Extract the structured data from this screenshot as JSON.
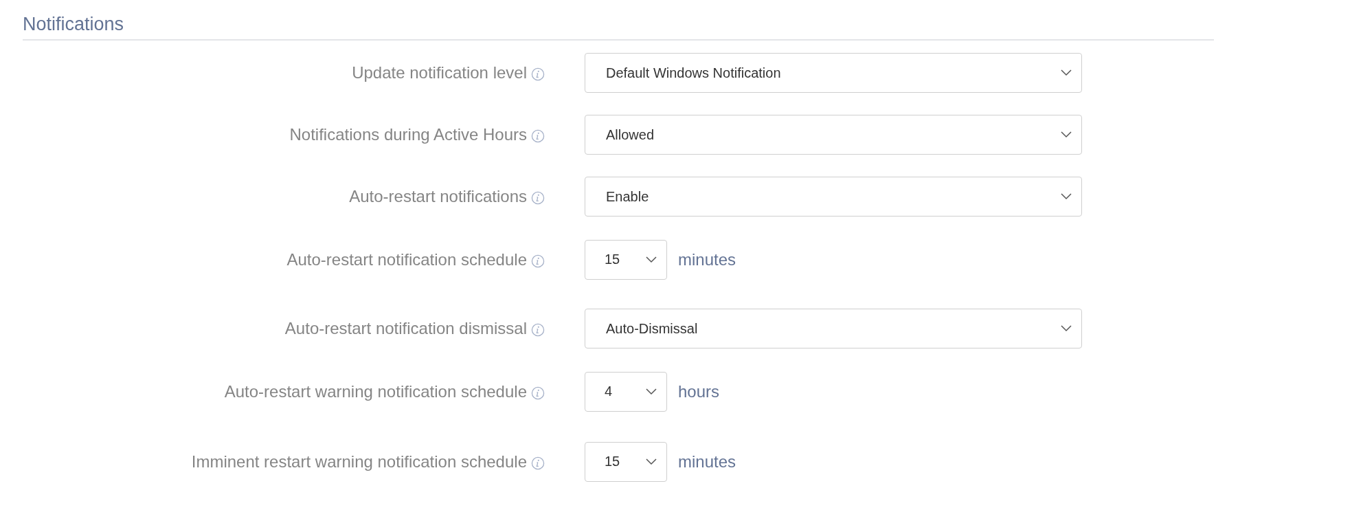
{
  "section": {
    "title": "Notifications"
  },
  "rows": [
    {
      "label": "Update notification level",
      "kind": "select",
      "value": "Default Windows Notification"
    },
    {
      "label": "Notifications during Active Hours",
      "kind": "select",
      "value": "Allowed"
    },
    {
      "label": "Auto-restart notifications",
      "kind": "select",
      "value": "Enable"
    },
    {
      "label": "Auto-restart notification schedule",
      "kind": "unit_select",
      "value": "15",
      "unit": "minutes"
    },
    {
      "label": "Auto-restart notification dismissal",
      "kind": "select",
      "value": "Auto-Dismissal"
    },
    {
      "label": "Auto-restart warning notification schedule",
      "kind": "unit_select",
      "value": "4",
      "unit": "hours"
    },
    {
      "label": "Imminent restart warning notification schedule",
      "kind": "unit_select",
      "value": "15",
      "unit": "minutes"
    }
  ]
}
